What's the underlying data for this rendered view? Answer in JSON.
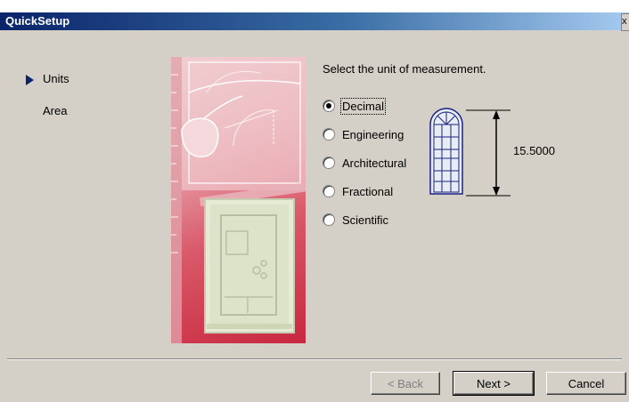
{
  "window": {
    "title": "QuickSetup",
    "close_label": "x"
  },
  "steps": [
    {
      "label": "Units",
      "current": true
    },
    {
      "label": "Area",
      "current": false
    }
  ],
  "units": {
    "prompt": "Select the unit of measurement.",
    "options": [
      {
        "label": "Decimal",
        "selected": true
      },
      {
        "label": "Engineering",
        "selected": false
      },
      {
        "label": "Architectural",
        "selected": false
      },
      {
        "label": "Fractional",
        "selected": false
      },
      {
        "label": "Scientific",
        "selected": false
      }
    ],
    "preview_value": "15.5000"
  },
  "buttons": {
    "back": "< Back",
    "next": "Next >",
    "cancel": "Cancel"
  },
  "colors": {
    "title_bar": "#0a246a",
    "art_accent": "#c8283f",
    "dialog_face": "#d4d0c8"
  }
}
